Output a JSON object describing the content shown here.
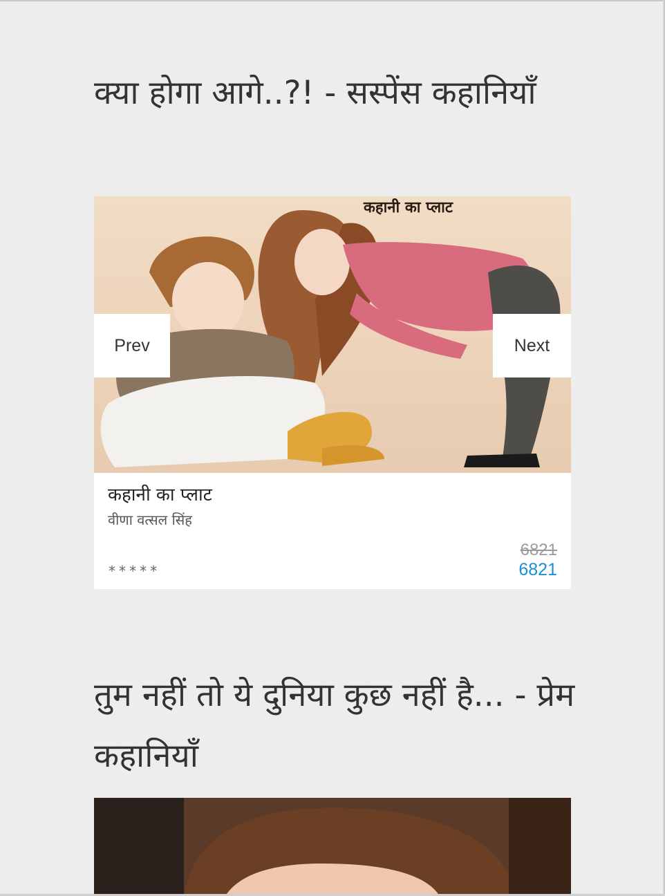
{
  "sections": [
    {
      "title": "क्या होगा आगे..?! - सस्पेंस कहानियाँ",
      "card": {
        "image_caption": "कहानी का प्लाट",
        "prev_label": "Prev",
        "next_label": "Next",
        "story_title": "कहानी का प्लाट",
        "author": "वीणा वत्सल सिंह",
        "rating": "*****",
        "price_old": "6821",
        "price_new": "6821"
      }
    },
    {
      "title": "तुम नहीं तो ये दुनिया कुछ नहीं है... - प्रेम कहानियाँ"
    }
  ],
  "colors": {
    "background": "#ededed",
    "card": "#ffffff",
    "price_accent": "#1b8fd6",
    "price_strike": "#9a9a9a",
    "title_text": "#333333"
  }
}
